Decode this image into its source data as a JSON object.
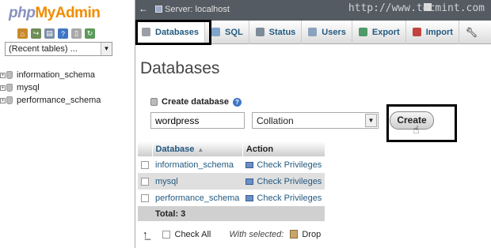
{
  "brand": {
    "php": "php",
    "my": "My",
    "admin": "Admin"
  },
  "left": {
    "recent_tables": "(Recent tables) ...",
    "databases": [
      "information_schema",
      "mysql",
      "performance_schema"
    ]
  },
  "topbar": {
    "server": "Server: localhost",
    "watermark": "http://www.tecmint.com"
  },
  "tabs": [
    {
      "label": "Databases",
      "icon": "database-icon",
      "color": "#9aa0a6"
    },
    {
      "label": "SQL",
      "icon": "sql-icon",
      "color": "#7fa3c9"
    },
    {
      "label": "Status",
      "icon": "status-icon",
      "color": "#7d8b99"
    },
    {
      "label": "Users",
      "icon": "users-icon",
      "color": "#8aa2bd"
    },
    {
      "label": "Export",
      "icon": "export-icon",
      "color": "#4e9a6b"
    },
    {
      "label": "Import",
      "icon": "import-icon",
      "color": "#c0453e"
    }
  ],
  "main": {
    "title": "Databases",
    "create_label": "Create database",
    "db_name_value": "wordpress",
    "collation": "Collation",
    "create_button": "Create"
  },
  "table": {
    "headers": {
      "database": "Database",
      "action": "Action"
    },
    "rows": [
      {
        "name": "information_schema",
        "action": "Check Privileges"
      },
      {
        "name": "mysql",
        "action": "Check Privileges"
      },
      {
        "name": "performance_schema",
        "action": "Check Privileges"
      }
    ],
    "total": "Total: 3"
  },
  "footer": {
    "check_all": "Check All",
    "with_selected": "With selected:",
    "drop": "Drop"
  },
  "colors": {
    "accent_link": "#235a81",
    "topbar": "#555b62",
    "logo_orange": "#f28c00",
    "logo_php": "#8892bf"
  }
}
